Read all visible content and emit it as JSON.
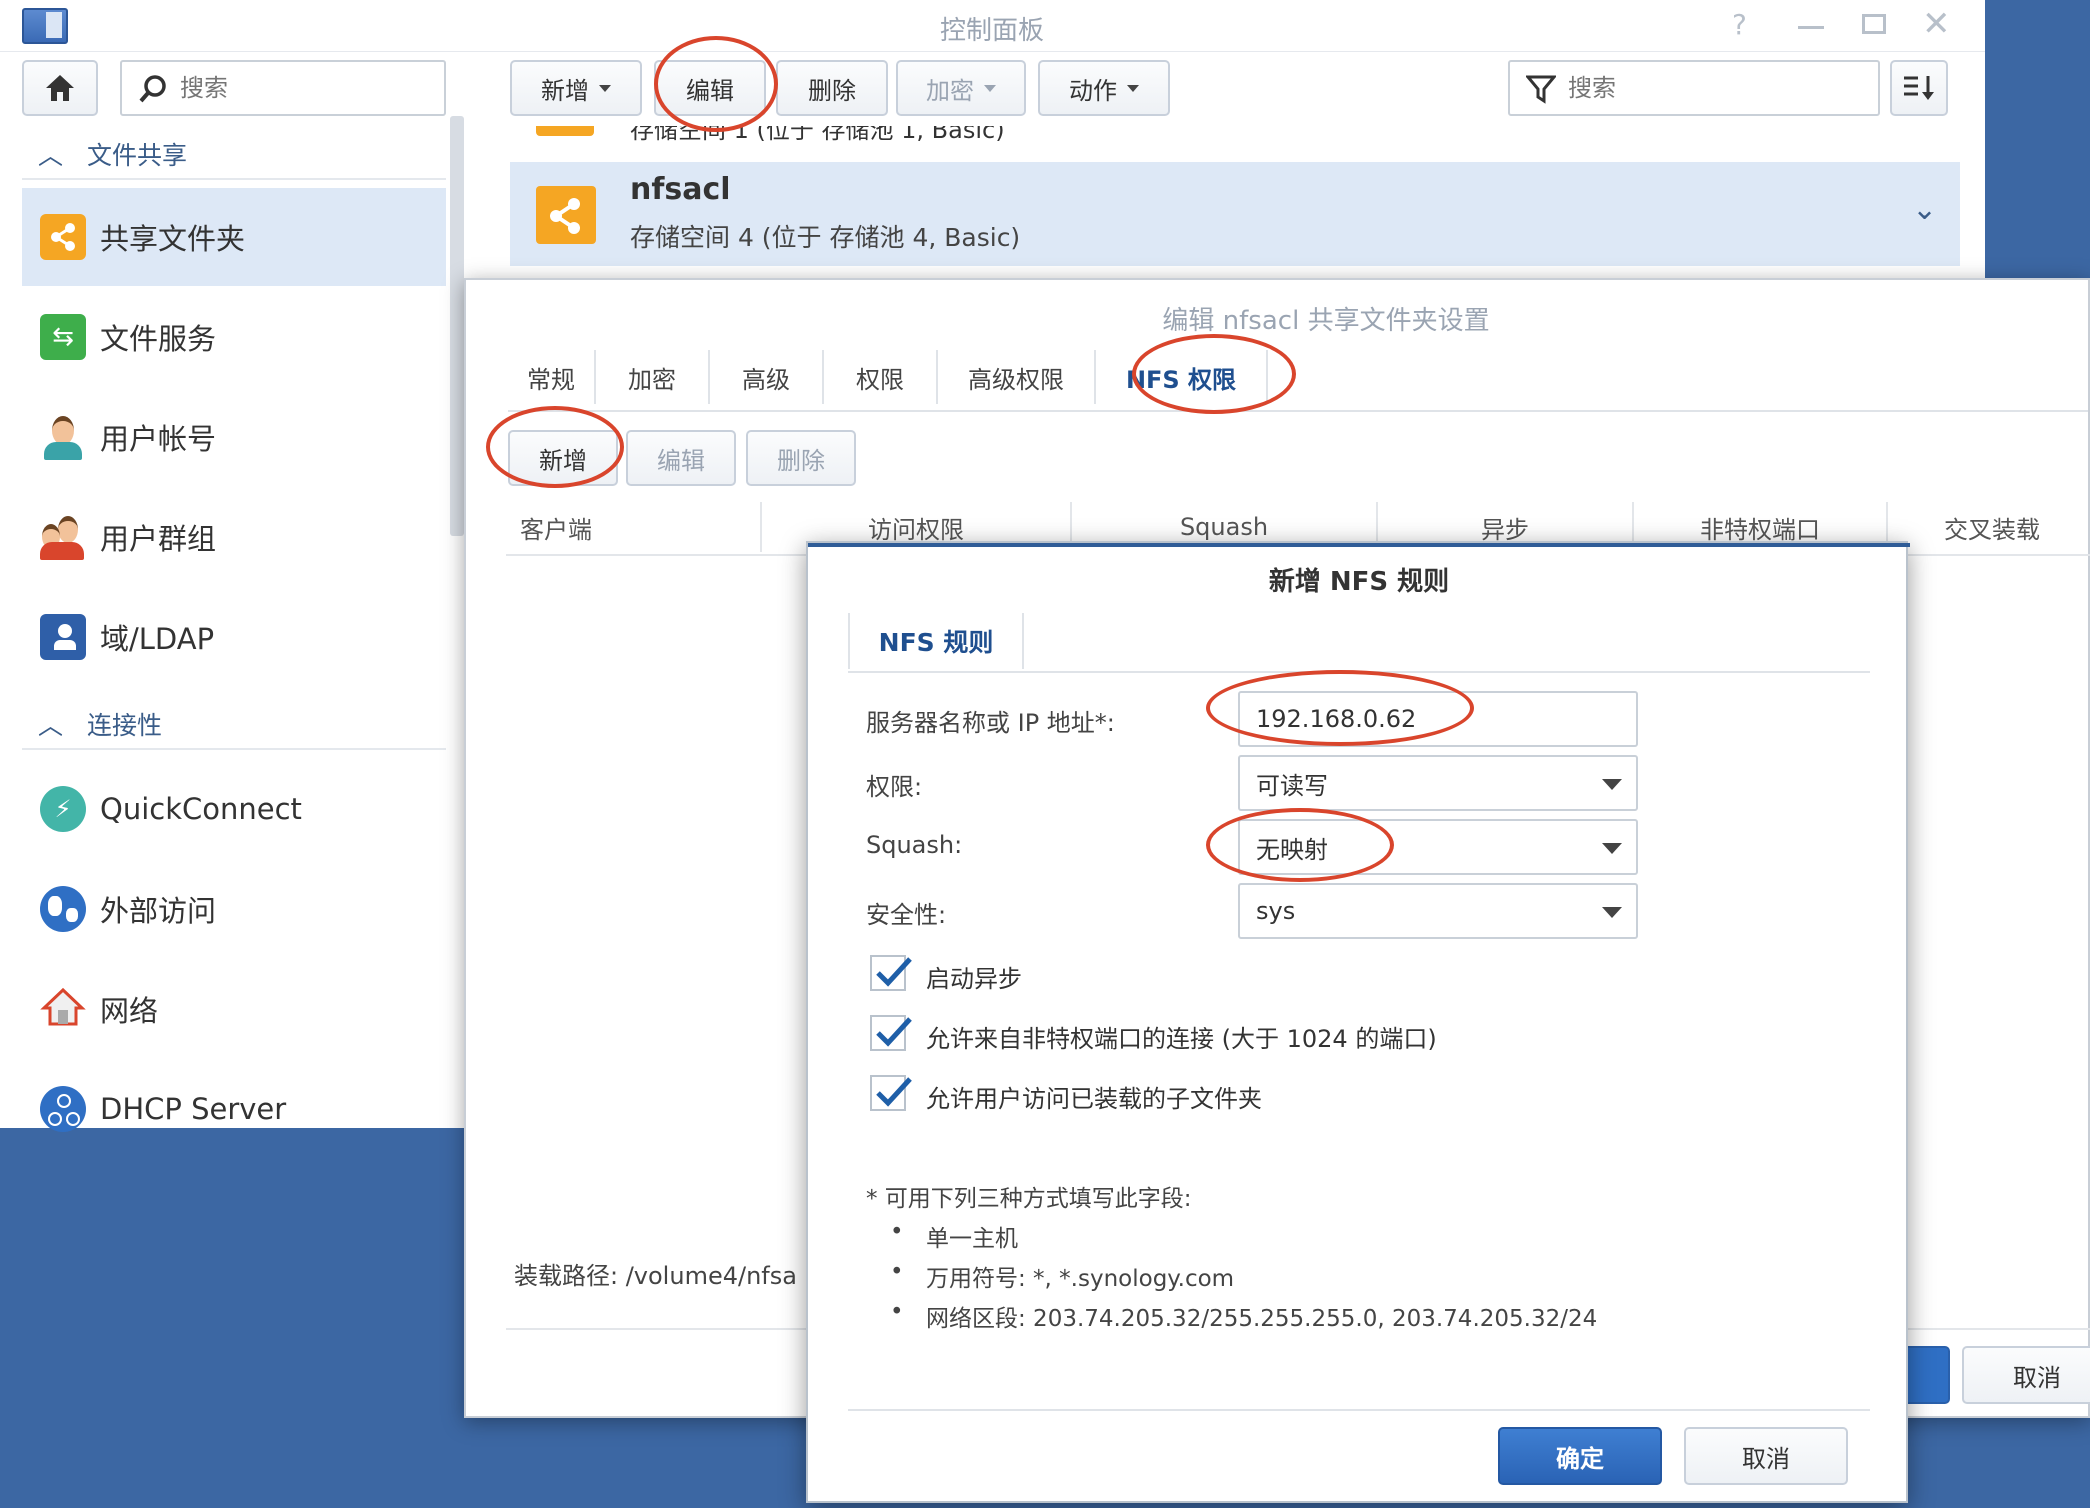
{
  "window": {
    "title": "控制面板"
  },
  "sidebar": {
    "search_placeholder": "搜索",
    "sections": [
      {
        "label": "文件共享"
      },
      {
        "label": "连接性"
      }
    ],
    "items": [
      {
        "label": "共享文件夹",
        "icon": "share-folder-icon",
        "selected": true
      },
      {
        "label": "文件服务",
        "icon": "file-services-icon"
      },
      {
        "label": "用户帐号",
        "icon": "user-icon"
      },
      {
        "label": "用户群组",
        "icon": "group-icon"
      },
      {
        "label": "域/LDAP",
        "icon": "ldap-icon"
      },
      {
        "label": "QuickConnect",
        "icon": "quickconnect-icon"
      },
      {
        "label": "外部访问",
        "icon": "globe-icon"
      },
      {
        "label": "网络",
        "icon": "home-network-icon"
      },
      {
        "label": "DHCP Server",
        "icon": "dhcp-icon"
      }
    ]
  },
  "toolbar": {
    "create": "新增",
    "edit": "编辑",
    "delete": "删除",
    "encrypt": "加密",
    "action": "动作",
    "search_placeholder": "搜索"
  },
  "share_list": {
    "partial_row": "存储空间 1 (位于 存储池 1, Basic)",
    "selected": {
      "name": "nfsacl",
      "location": "存储空间 4 (位于 存储池 4, Basic)"
    }
  },
  "edit_dialog": {
    "title": "编辑 nfsacl 共享文件夹设置",
    "tabs": [
      "常规",
      "加密",
      "高级",
      "权限",
      "高级权限",
      "NFS 权限"
    ],
    "active_tab": "NFS 权限",
    "buttons": {
      "create": "新增",
      "edit": "编辑",
      "delete": "删除"
    },
    "columns": [
      "客户端",
      "访问权限",
      "Squash",
      "异步",
      "非特权端口",
      "交叉装载"
    ],
    "mount_path": "装载路径: /volume4/nfsa",
    "cancel": "取消"
  },
  "nfs_rule_dialog": {
    "title": "新增 NFS 规则",
    "tab": "NFS 规则",
    "fields": {
      "host_label": "服务器名称或 IP 地址*:",
      "host_value": "192.168.0.62",
      "privilege_label": "权限:",
      "privilege_value": "可读写",
      "squash_label": "Squash:",
      "squash_value": "无映射",
      "security_label": "安全性:",
      "security_value": "sys"
    },
    "checkboxes": [
      {
        "label": "启动异步",
        "checked": true
      },
      {
        "label": "允许来自非特权端口的连接 (大于 1024 的端口)",
        "checked": true
      },
      {
        "label": "允许用户访问已装载的子文件夹",
        "checked": true
      }
    ],
    "note": {
      "heading": "* 可用下列三种方式填写此字段:",
      "items": [
        "单一主机",
        "万用符号: *, *.synology.com",
        "网络区段: 203.74.205.32/255.255.255.0, 203.74.205.32/24"
      ]
    },
    "ok": "确定",
    "cancel": "取消"
  },
  "colors": {
    "accent": "#2f6fc4",
    "selected_bg": "#dde8f6",
    "highlight_ring": "#d9452c",
    "desktop": "#3c67a3"
  }
}
